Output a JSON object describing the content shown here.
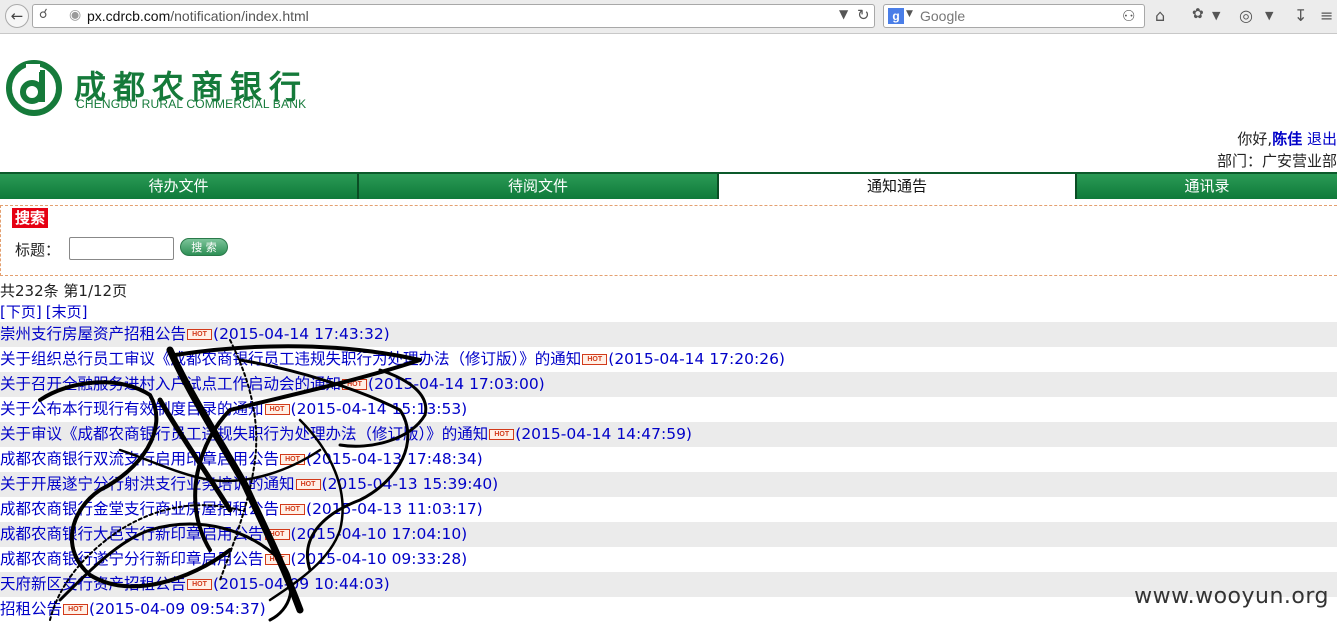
{
  "browser": {
    "url_host": "px.cdrcb.com",
    "url_path": "/notification/index.html",
    "search_placeholder": "Google"
  },
  "header": {
    "logo_cn": "成都农商银行",
    "logo_en": "CHENGDU RURAL COMMERCIAL BANK",
    "greeting": "你好,",
    "user_name": "陈佳",
    "logout": "退出",
    "dept_label": "部门：",
    "dept_value": "广安营业部"
  },
  "tabs": [
    {
      "label": "待办文件"
    },
    {
      "label": "待阅文件"
    },
    {
      "label": "通知通告"
    },
    {
      "label": "通讯录"
    }
  ],
  "search": {
    "title": "搜索",
    "field_label": "标题：",
    "field_value": "",
    "button_label": "搜 索"
  },
  "summary": {
    "count_text": "共232条 第1/12页"
  },
  "pager": {
    "next": "[下页]",
    "last": "[末页]"
  },
  "hot_label": "HOT",
  "notices": [
    {
      "title": "崇州支行房屋资产招租公告",
      "date": "(2015-04-14 17:43:32)"
    },
    {
      "title": "关于组织总行员工审议《成都农商银行员工违规失职行为处理办法（修订版）》的通知",
      "date": "(2015-04-14 17:20:26)"
    },
    {
      "title": "关于召开全融服务进村入户试点工作启动会的通知",
      "date": "(2015-04-14 17:03:00)"
    },
    {
      "title": "关于公布本行现行有效制度目录的通知",
      "date": "(2015-04-14 15:13:53)"
    },
    {
      "title": "关于审议《成都农商银行员工违规失职行为处理办法（修订版）》的通知",
      "date": "(2015-04-14 14:47:59)"
    },
    {
      "title": "成都农商银行双流支行启用印章启用公告",
      "date": "(2015-04-13 17:48:34)"
    },
    {
      "title": "关于开展遂宁分行射洪支行业务培训的通知",
      "date": "(2015-04-13 15:39:40)"
    },
    {
      "title": "成都农商银行金堂支行商业房屋招租公告",
      "date": "(2015-04-13 11:03:17)"
    },
    {
      "title": "成都农商银行大邑支行新印章启用公告",
      "date": "(2015-04-10 17:04:10)"
    },
    {
      "title": "成都农商银行遂宁分行新印章启用公告",
      "date": "(2015-04-10 09:33:28)"
    },
    {
      "title": "天府新区支行资产招租公告",
      "date": "(2015-04-09 10:44:03)"
    },
    {
      "title": "招租公告",
      "date": "(2015-04-09 09:54:37)"
    }
  ],
  "watermark": "www.wooyun.org",
  "colors": {
    "brand_green": "#157a3a",
    "link_blue": "#0000c8",
    "badge_red": "#e60012"
  }
}
